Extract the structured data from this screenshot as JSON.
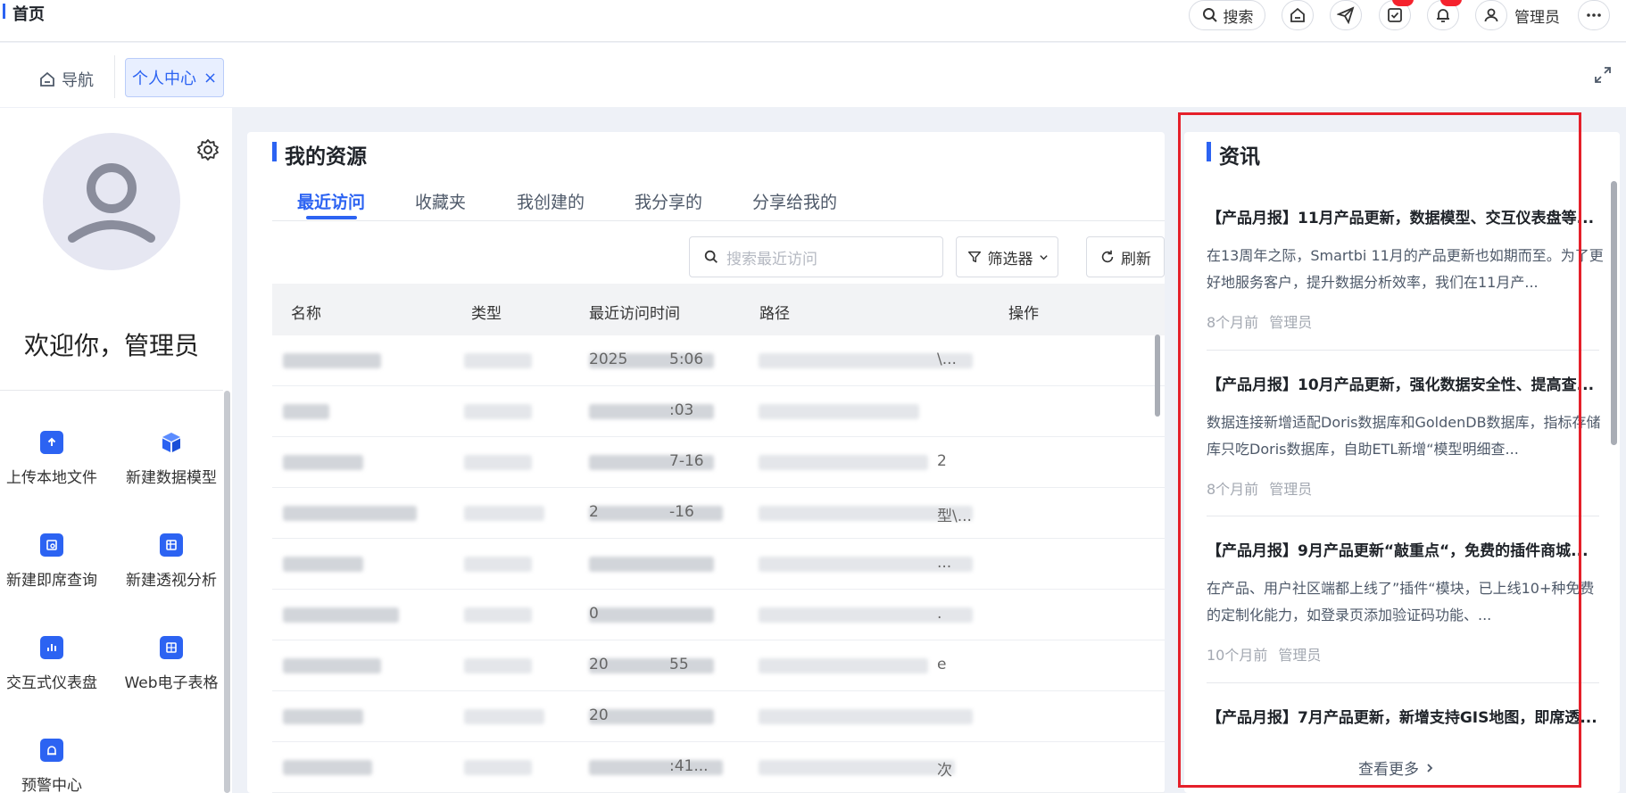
{
  "header": {
    "page_title": "首页",
    "search_label": "搜索",
    "user_name": "管理员"
  },
  "tabs": {
    "nav_label": "导航",
    "active_label": "个人中心"
  },
  "profile": {
    "welcome": "欢迎你，管理员",
    "quick_actions": [
      {
        "label": "上传本地文件",
        "icon": "upload-icon"
      },
      {
        "label": "新建数据模型",
        "icon": "cube-icon"
      },
      {
        "label": "新建即席查询",
        "icon": "query-icon"
      },
      {
        "label": "新建透视分析",
        "icon": "pivot-icon"
      },
      {
        "label": "交互式仪表盘",
        "icon": "dashboard-icon"
      },
      {
        "label": "Web电子表格",
        "icon": "spreadsheet-icon"
      },
      {
        "label": "预警中心",
        "icon": "alarm-icon"
      }
    ]
  },
  "resources": {
    "title": "我的资源",
    "tabs": [
      "最近访问",
      "收藏夹",
      "我创建的",
      "我分享的",
      "分享给我的"
    ],
    "active_tab": "最近访问",
    "search_placeholder": "搜索最近访问",
    "filter_label": "筛选器",
    "refresh_label": "刷新",
    "columns": [
      "名称",
      "类型",
      "最近访问时间",
      "路径",
      "操作"
    ],
    "rows": [
      {
        "time_visible": "2025",
        "time_tail": "5:06",
        "path_tail": "\\..."
      },
      {
        "time_visible": "",
        "time_tail": ":03",
        "path_tail": ""
      },
      {
        "time_visible": "",
        "time_tail": "7-16",
        "path_tail": "2"
      },
      {
        "time_visible": "2",
        "time_tail": "-16",
        "path_tail": "型\\..."
      },
      {
        "time_visible": "",
        "time_tail": "",
        "path_tail": "..."
      },
      {
        "time_visible": "0",
        "time_tail": "",
        "path_tail": "."
      },
      {
        "time_visible": "20",
        "time_tail": "55",
        "path_tail": "e"
      },
      {
        "time_visible": "20",
        "time_tail": "",
        "path_tail": ""
      },
      {
        "time_visible": "",
        "time_tail": ":41...",
        "path_tail": "次"
      }
    ]
  },
  "news": {
    "title": "资讯",
    "items": [
      {
        "title": "【产品月报】11月产品更新，数据模型、交互仪表盘等...",
        "summary": "在13周年之际，Smartbi 11月的产品更新也如期而至。为了更好地服务客户，提升数据分析效率，我们在11月产...",
        "time": "8个月前",
        "author": "管理员"
      },
      {
        "title": "【产品月报】10月产品更新，强化数据安全性、提高查...",
        "summary": "数据连接新增适配Doris数据库和GoldenDB数据库，指标存储库只吃Doris数据库，自助ETL新增“模型明细查...",
        "time": "8个月前",
        "author": "管理员"
      },
      {
        "title": "【产品月报】9月产品更新“敲重点“，免费的插件商城...",
        "summary": "在产品、用户社区端都上线了”插件“模块，已上线10+种免费的定制化能力，如登录页添加验证码功能、...",
        "time": "10个月前",
        "author": "管理员"
      },
      {
        "title": "【产品月报】7月产品更新，新增支持GIS地图，即席透...",
        "summary": "",
        "time": "",
        "author": ""
      }
    ],
    "more_label": "查看更多"
  },
  "colors": {
    "accent": "#2c63f2",
    "highlight": "#e5202a",
    "badge": "#f5222d"
  }
}
